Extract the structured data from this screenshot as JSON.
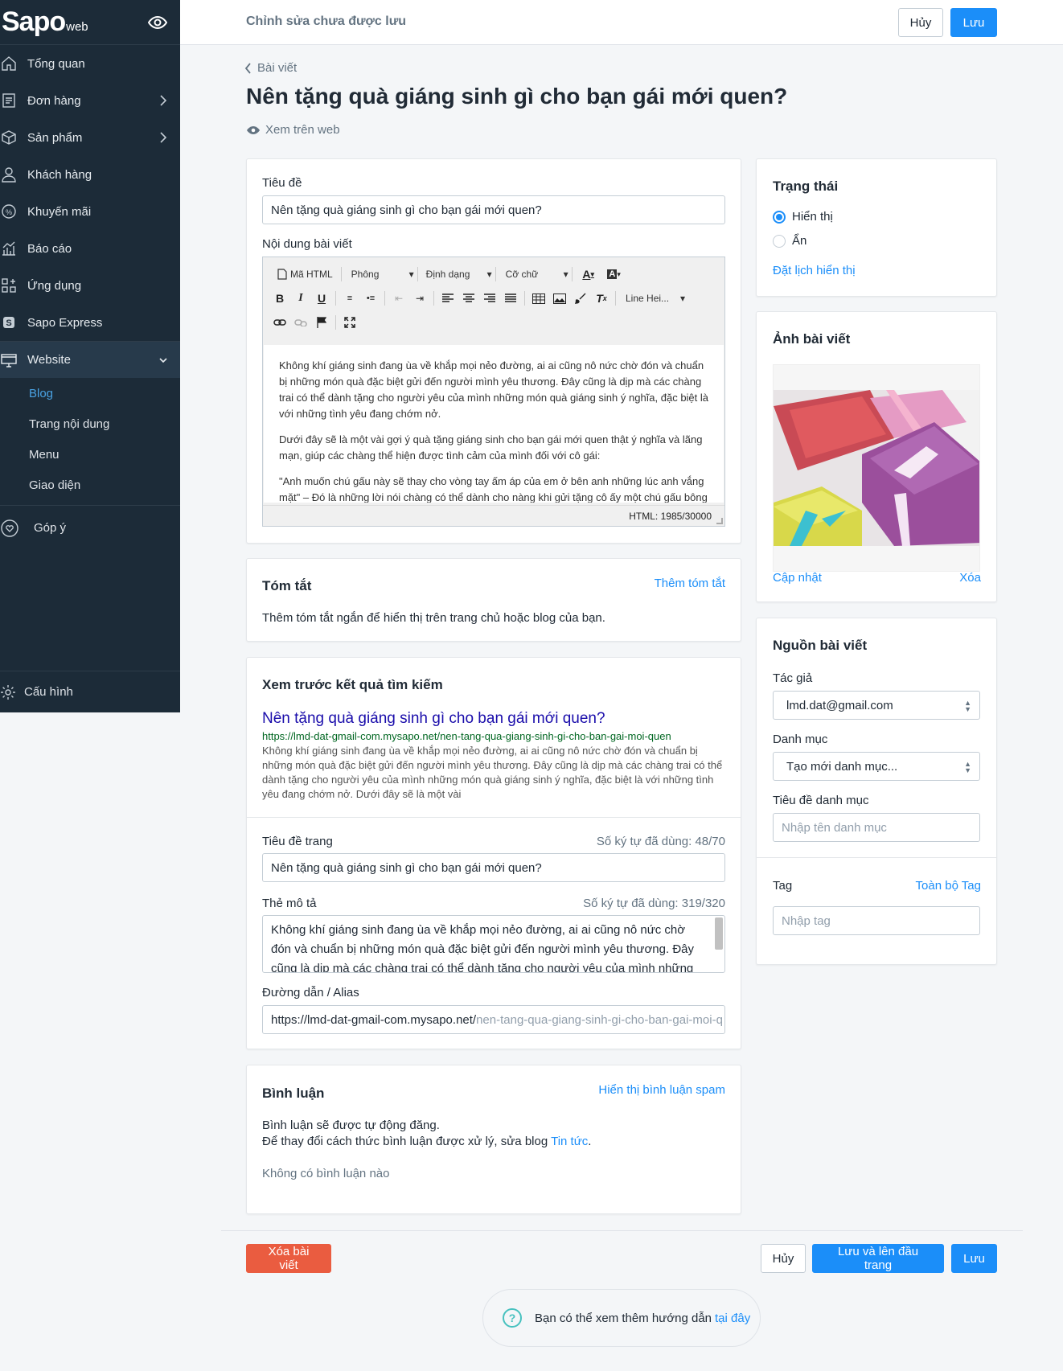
{
  "sidebar": {
    "brand": "Sapo",
    "brand_suffix": "web",
    "items": [
      {
        "label": "Tổng quan",
        "icon": "home-icon"
      },
      {
        "label": "Đơn hàng",
        "icon": "orders-icon"
      },
      {
        "label": "Sản phẩm",
        "icon": "box-icon"
      },
      {
        "label": "Khách hàng",
        "icon": "user-icon"
      },
      {
        "label": "Khuyến mãi",
        "icon": "discount-icon"
      },
      {
        "label": "Báo cáo",
        "icon": "chart-icon"
      },
      {
        "label": "Ứng dụng",
        "icon": "apps-icon"
      },
      {
        "label": "Sapo Express",
        "icon": "sapo-express-icon"
      },
      {
        "label": "Website",
        "icon": "monitor-icon"
      }
    ],
    "website_sub": [
      "Blog",
      "Trang nội dung",
      "Menu",
      "Giao diện"
    ],
    "feedback": "Góp ý",
    "settings": "Cấu hình"
  },
  "topbar": {
    "message": "Chỉnh sửa chưa được lưu",
    "cancel": "Hủy",
    "save": "Lưu"
  },
  "page": {
    "breadcrumb": "Bài viết",
    "title": "Nên tặng quà giáng sinh gì cho bạn gái mới quen?",
    "view_on_web": "Xem trên web"
  },
  "article": {
    "title_label": "Tiêu đề",
    "title_value": "Nên tặng quà giáng sinh gì cho bạn gái mới quen?",
    "content_label": "Nội dung bài viết",
    "toolbar": {
      "html": "Mã HTML",
      "font": "Phông",
      "format": "Định dạng",
      "size": "Cỡ chữ",
      "line_height": "Line Hei..."
    },
    "paragraphs": [
      "Không khí giáng sinh đang ùa về khắp mọi nẻo đường, ai ai cũng nô nức chờ đón và chuẩn bị những món quà đặc biệt gửi đến người mình yêu thương. Đây cũng là dịp mà các chàng trai có thể dành tặng cho người yêu của mình những món quà giáng sinh ý nghĩa, đặc biệt là với những tình yêu đang chớm nở.",
      "Dưới đây sẽ là một vài gợi ý quà tặng giáng sinh cho bạn gái mới quen thật ý nghĩa và lãng mạn, giúp các chàng thể hiện được tình cảm của mình đối với cô gái:",
      "\"Anh muốn chú gấu này sẽ thay cho vòng tay ấm áp của em ở bên anh những lúc anh vắng mặt\" – Đó là những lời nói chàng có thể dành cho nàng khi gửi tặng cô ấy một chú gấu bông"
    ],
    "html_count": "HTML: 1985/30000"
  },
  "summary": {
    "title": "Tóm tắt",
    "add": "Thêm tóm tắt",
    "hint": "Thêm tóm tắt ngắn để hiển thị trên trang chủ hoặc blog của bạn."
  },
  "seo": {
    "title": "Xem trước kết quả tìm kiếm",
    "preview_title": "Nên tặng quà giáng sinh gì cho bạn gái mới quen?",
    "preview_url": "https://lmd-dat-gmail-com.mysapo.net/nen-tang-qua-giang-sinh-gi-cho-ban-gai-moi-quen",
    "preview_desc": "Không khí giáng sinh đang ùa về khắp mọi nẻo đường, ai ai cũng nô nức chờ đón và chuẩn bị những món quà đặc biệt gửi đến người mình yêu thương. Đây cũng là dịp mà các chàng trai có thể dành tặng cho người yêu của mình những món quà giáng sinh ý nghĩa, đặc biệt là với những tình yêu đang chớm nở. Dưới đây sẽ là một vài",
    "page_title_label": "Tiêu đề trang",
    "page_title_count": "Số ký tự đã dùng: 48/70",
    "page_title_value": "Nên tặng quà giáng sinh gì cho bạn gái mới quen?",
    "desc_label": "Thẻ mô tả",
    "desc_count": "Số ký tự đã dùng: 319/320",
    "desc_value": "Không khí giáng sinh đang ùa về khắp mọi nẻo đường, ai ai cũng nô nức chờ đón và chuẩn bị những món quà đặc biệt gửi đến người mình yêu thương. Đây cũng là dịp mà các chàng trai có thể dành tặng cho người yêu của mình những món quà giáng",
    "alias_label": "Đường dẫn / Alias",
    "alias_prefix": "https://lmd-dat-gmail-com.mysapo.net/",
    "alias_value": "nen-tang-qua-giang-sinh-gi-cho-ban-gai-moi-q"
  },
  "comments": {
    "title": "Bình luận",
    "spam_link": "Hiển thị bình luận spam",
    "line1": "Bình luận sẽ được tự động đăng.",
    "line2": "Để thay đổi cách thức bình luận được xử lý, sửa blog",
    "blog_link": "Tin tức",
    "none": "Không có bình luận nào"
  },
  "status": {
    "title": "Trạng thái",
    "visible": "Hiển thị",
    "hidden": "Ẩn",
    "schedule": "Đặt lịch hiển thị",
    "selected": "visible"
  },
  "image": {
    "title": "Ảnh bài viết",
    "update": "Cập nhật",
    "delete": "Xóa"
  },
  "source": {
    "title": "Nguồn bài viết",
    "author_label": "Tác giả",
    "author_value": "lmd.dat@gmail.com",
    "category_label": "Danh mục",
    "category_value": "Tạo mới danh mục...",
    "category_title_label": "Tiêu đề danh mục",
    "category_title_placeholder": "Nhập tên danh mục",
    "tag_label": "Tag",
    "all_tags": "Toàn bộ Tag",
    "tag_placeholder": "Nhập tag"
  },
  "footer": {
    "delete": "Xóa bài viết",
    "cancel": "Hủy",
    "save_top": "Lưu và lên đầu trang",
    "save": "Lưu",
    "help_text": "Bạn có thể xem thêm hướng dẫn",
    "help_link": "tại đây"
  },
  "colors": {
    "sidebar": "#1c2b38",
    "accent": "#1b8ef9",
    "danger": "#ea5c40"
  }
}
